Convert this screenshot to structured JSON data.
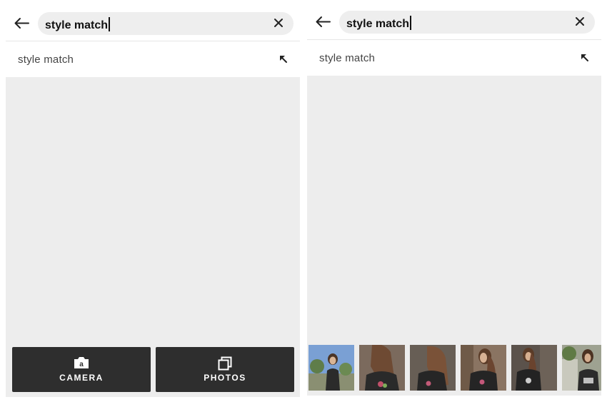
{
  "screens": [
    {
      "search": {
        "query": "style match"
      },
      "suggestions": [
        {
          "label": "style match"
        }
      ],
      "actions": {
        "camera_label": "CAMERA",
        "photos_label": "PHOTOS"
      }
    },
    {
      "search": {
        "query": "style match"
      },
      "suggestions": [
        {
          "label": "style match"
        }
      ],
      "photos": [
        {
          "name": "photo-thumb-1",
          "bg": "#6f93c7"
        },
        {
          "name": "photo-thumb-2",
          "bg": "#7a5a44"
        },
        {
          "name": "photo-thumb-3",
          "bg": "#6a5a4e"
        },
        {
          "name": "photo-thumb-4",
          "bg": "#7c5f49"
        },
        {
          "name": "photo-thumb-5",
          "bg": "#5a5047"
        },
        {
          "name": "photo-thumb-6",
          "bg": "#8e8f7d"
        }
      ]
    }
  ],
  "colors": {
    "background": "#ededed",
    "search_pill": "#eeeeee",
    "button_dark": "#2e2e2e",
    "text": "#111111"
  },
  "icons": [
    "back-arrow-icon",
    "close-icon",
    "arrow-up-left-icon",
    "camera-icon",
    "photos-icon"
  ]
}
